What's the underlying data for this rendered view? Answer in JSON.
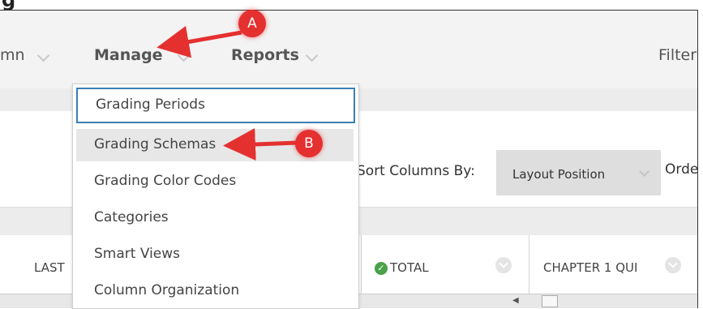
{
  "page_title_fragment": "g",
  "topbar": {
    "menus": [
      {
        "label": "mn",
        "chevron": true
      },
      {
        "label": "Manage",
        "chevron": true
      },
      {
        "label": "Reports",
        "chevron": true
      },
      {
        "label": "Filter",
        "chevron": false
      }
    ]
  },
  "dropdown": {
    "items": [
      {
        "label": "Grading Periods",
        "state": "focused"
      },
      {
        "label": "Grading Schemas",
        "state": "hover"
      },
      {
        "label": "Grading Color Codes",
        "state": "normal"
      },
      {
        "label": "Categories",
        "state": "normal"
      },
      {
        "label": "Smart Views",
        "state": "normal"
      },
      {
        "label": "Column Organization",
        "state": "normal"
      }
    ]
  },
  "sort": {
    "label": "Sort Columns By:",
    "selected": "Layout Position",
    "order_label": "Orde"
  },
  "grid": {
    "columns": [
      "LAST",
      "TOTAL",
      "CHAPTER 1 QUI"
    ]
  },
  "annotations": {
    "a": "A",
    "b": "B",
    "color": "#e53030"
  },
  "colors": {
    "focus_border": "#3b7fb5",
    "hover_bg": "#e7e7e7",
    "check": "#4aa24a"
  }
}
